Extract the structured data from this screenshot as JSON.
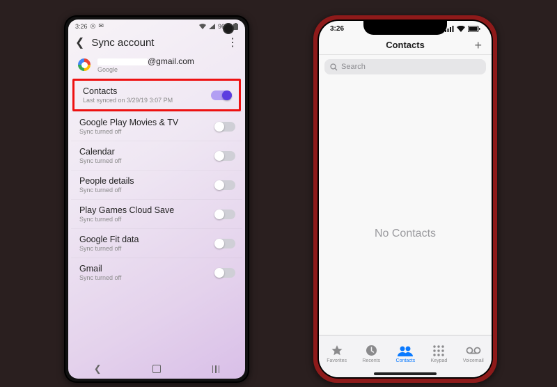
{
  "android": {
    "status": {
      "time": "3:26",
      "battery_pct": "96%"
    },
    "header": {
      "title": "Sync account"
    },
    "account": {
      "email_suffix": "@gmail.com",
      "provider": "Google"
    },
    "items": [
      {
        "title": "Contacts",
        "subtitle": "Last synced on 3/29/19 3:07 PM",
        "on": true,
        "highlight": true
      },
      {
        "title": "Google Play Movies & TV",
        "subtitle": "Sync turned off",
        "on": false,
        "highlight": false
      },
      {
        "title": "Calendar",
        "subtitle": "Sync turned off",
        "on": false,
        "highlight": false
      },
      {
        "title": "People details",
        "subtitle": "Sync turned off",
        "on": false,
        "highlight": false
      },
      {
        "title": "Play Games Cloud Save",
        "subtitle": "Sync turned off",
        "on": false,
        "highlight": false
      },
      {
        "title": "Google Fit data",
        "subtitle": "Sync turned off",
        "on": false,
        "highlight": false
      },
      {
        "title": "Gmail",
        "subtitle": "Sync turned off",
        "on": false,
        "highlight": false
      }
    ]
  },
  "iphone": {
    "status": {
      "time": "3:26"
    },
    "header": {
      "title": "Contacts",
      "add": "+"
    },
    "search": {
      "placeholder": "Search"
    },
    "empty": "No Contacts",
    "tabs": [
      {
        "label": "Favorites",
        "icon": "star",
        "active": false
      },
      {
        "label": "Recents",
        "icon": "clock",
        "active": false
      },
      {
        "label": "Contacts",
        "icon": "contacts",
        "active": true
      },
      {
        "label": "Keypad",
        "icon": "keypad",
        "active": false
      },
      {
        "label": "Voicemail",
        "icon": "voicemail",
        "active": false
      }
    ]
  }
}
